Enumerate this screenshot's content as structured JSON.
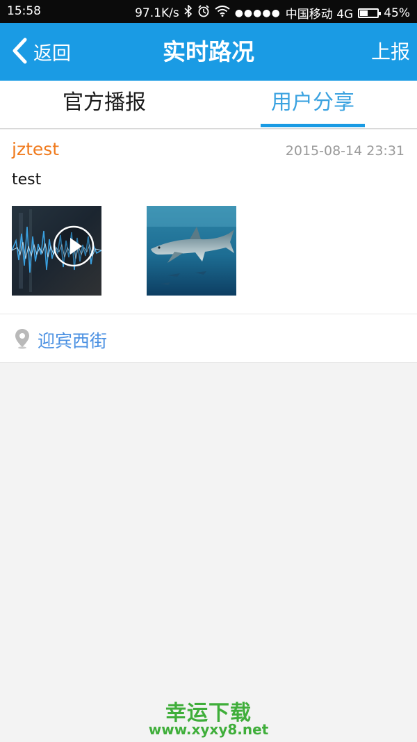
{
  "status_bar": {
    "time": "15:58",
    "net_speed": "97.1K/s",
    "carrier": "中国移动 4G",
    "battery": "45%",
    "battery_level": 0.45
  },
  "header": {
    "back_label": "返回",
    "title": "实时路况",
    "action_label": "上报"
  },
  "tabs": [
    {
      "label": "官方播报",
      "active": false
    },
    {
      "label": "用户分享",
      "active": true
    }
  ],
  "post": {
    "user": "jztest",
    "timestamp": "2015-08-14 23:31",
    "content": "test",
    "media": [
      {
        "type": "video",
        "icon": "play-icon"
      },
      {
        "type": "image",
        "subject": "shark"
      }
    ],
    "location": "迎宾西街"
  },
  "watermark": {
    "title": "幸运下载",
    "url": "www.xyxy8.net"
  },
  "colors": {
    "header_bg": "#1a9be4",
    "active_tab": "#3aa2e0",
    "username": "#f07a1c",
    "location_text": "#4a90e2",
    "watermark": "#3fae3a"
  }
}
